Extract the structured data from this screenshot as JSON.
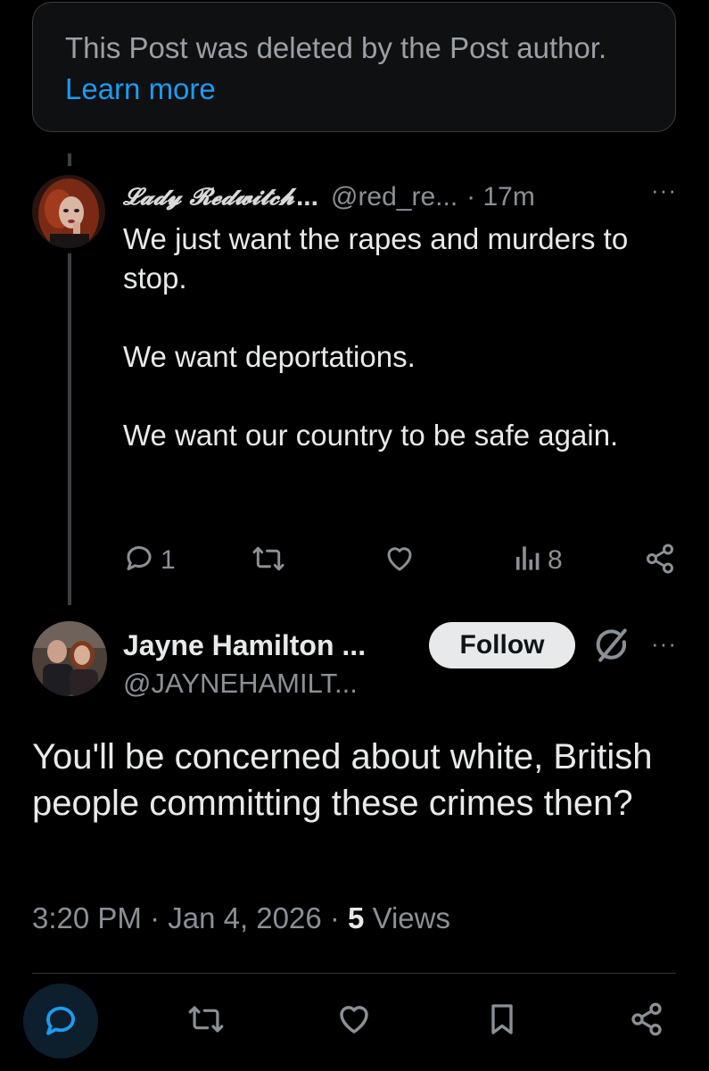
{
  "deleted_notice": {
    "text": "This Post was deleted by the Post author.",
    "link": "Learn more"
  },
  "reply_post": {
    "display_name": "𝓛𝓪𝓭𝔂 𝓡𝓮𝓭𝔀𝓲𝓽𝓬𝓱",
    "name_ellipsis": "...",
    "handle": "@red_re...",
    "time": "· 17m",
    "more": "···",
    "paragraphs": [
      "We just want the rapes and murders to stop.",
      "We want deportations.",
      "We want our country to be safe again."
    ],
    "stats": {
      "replies": "1",
      "views": "8"
    }
  },
  "main_post": {
    "display_name": "Jayne Hamilton ...",
    "handle": "@JAYNEHAMILT...",
    "follow_label": "Follow",
    "more": "···",
    "text": "You'll be concerned about white, British people committing these crimes then?",
    "time": "3:20 PM · Jan 4, 2026 ·",
    "views_count": "5",
    "views_label": "Views"
  },
  "colors": {
    "background": "#000000",
    "text": "#e7e9ea",
    "muted": "#8b9096",
    "link": "#1d9bf0",
    "reply_highlight": "#0d1f2d"
  },
  "icons": [
    "reply-icon",
    "repost-icon",
    "like-icon",
    "views-icon",
    "share-icon",
    "grok-icon",
    "bookmark-icon",
    "more-icon"
  ]
}
